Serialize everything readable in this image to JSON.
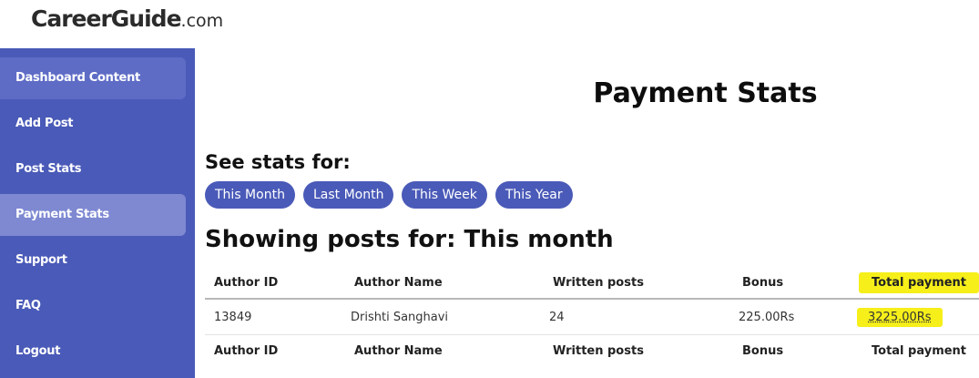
{
  "header": {
    "logo_main": "CareerGuide",
    "logo_suffix": ".com"
  },
  "sidebar": {
    "items": [
      {
        "label": "Dashboard Content"
      },
      {
        "label": "Add Post"
      },
      {
        "label": "Post Stats"
      },
      {
        "label": "Payment Stats"
      },
      {
        "label": "Support"
      },
      {
        "label": "FAQ"
      },
      {
        "label": "Logout"
      }
    ],
    "active": "Payment Stats",
    "color": "#4a5ab8"
  },
  "main": {
    "title": "Payment Stats",
    "see_stats_label": "See stats for:",
    "filters": [
      "This Month",
      "Last Month",
      "This Week",
      "This Year"
    ],
    "showing_text": "Showing posts for: This month",
    "table": {
      "columns": [
        "Author ID",
        "Author Name",
        "Written posts",
        "Bonus",
        "Total payment"
      ],
      "rows": [
        [
          "13849",
          "Drishti Sanghavi",
          "24",
          "225.00Rs",
          "3225.00Rs"
        ]
      ],
      "footer_columns": [
        "Author ID",
        "Author Name",
        "Written posts",
        "Bonus",
        "Total payment"
      ]
    },
    "highlight_color": "#f6ef1a"
  }
}
